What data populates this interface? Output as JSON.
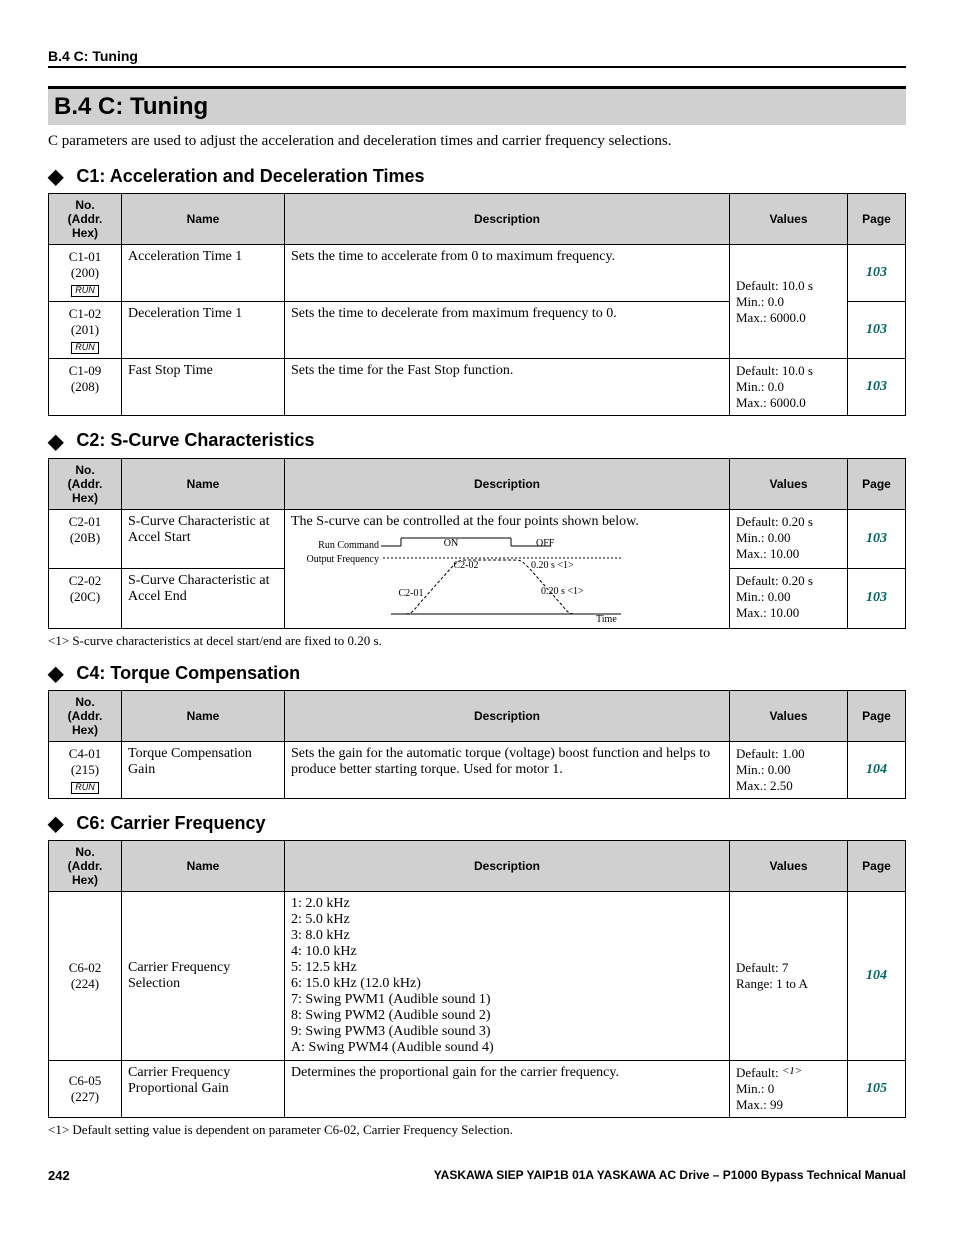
{
  "running_head": "B.4 C: Tuning",
  "section_title": "B.4   C: Tuning",
  "section_intro": "C parameters are used to adjust the acceleration and deceleration times and carrier frequency selections.",
  "subsections": {
    "c1": {
      "heading": "C1: Acceleration and Deceleration Times",
      "headers": {
        "no": "No.\n(Addr.\nHex)",
        "name": "Name",
        "desc": "Description",
        "values": "Values",
        "page": "Page"
      },
      "rows": [
        {
          "no_line1": "C1-01",
          "no_line2": "(200)",
          "run": "RUN",
          "name": "Acceleration Time 1",
          "desc": "Sets the time to accelerate from 0 to maximum frequency.",
          "page": "103"
        },
        {
          "no_line1": "C1-02",
          "no_line2": "(201)",
          "run": "RUN",
          "name": "Deceleration Time 1",
          "desc": "Sets the time to decelerate from maximum frequency to 0.",
          "page": "103"
        },
        {
          "no_line1": "C1-09",
          "no_line2": "(208)",
          "run": "",
          "name": "Fast Stop Time",
          "desc": "Sets the time for the Fast Stop function.",
          "values": "Default: 10.0 s\nMin.: 0.0\nMax.: 6000.0",
          "page": "103"
        }
      ],
      "shared_values_12": "Default: 10.0 s\nMin.: 0.0\nMax.: 6000.0"
    },
    "c2": {
      "heading": "C2: S-Curve Characteristics",
      "headers": {
        "no": "No.\n(Addr.\nHex)",
        "name": "Name",
        "desc": "Description",
        "values": "Values",
        "page": "Page"
      },
      "rows": [
        {
          "no_line1": "C2-01",
          "no_line2": "(20B)",
          "name": "S-Curve Characteristic at Accel Start",
          "values": "Default: 0.20 s\nMin.: 0.00\nMax.: 10.00",
          "page": "103"
        },
        {
          "no_line1": "C2-02",
          "no_line2": "(20C)",
          "name": "S-Curve Characteristic at Accel End",
          "values": "Default: 0.20 s\nMin.: 0.00\nMax.: 10.00",
          "page": "103"
        }
      ],
      "desc_intro": "The S-curve can be controlled at the four points shown below.",
      "diagram_labels": {
        "run_command": "Run Command",
        "on": "ON",
        "off": "OFF",
        "output_freq": "Output Frequency",
        "c2_01": "C2-01",
        "c2_02": "C2-02",
        "note_c2_02": "0.20 s <1>",
        "note_c2_01": "0.20 s <1>",
        "time": "Time"
      },
      "footnote": "<1>   S-curve characteristics at decel start/end are fixed to 0.20 s."
    },
    "c4": {
      "heading": "C4: Torque Compensation",
      "headers": {
        "no": "No.\n(Addr.\nHex)",
        "name": "Name",
        "desc": "Description",
        "values": "Values",
        "page": "Page"
      },
      "rows": [
        {
          "no_line1": "C4-01",
          "no_line2": "(215)",
          "run": "RUN",
          "name": "Torque Compensation Gain",
          "desc": "Sets the gain for the automatic torque (voltage) boost function and helps to produce better starting torque. Used for motor 1.",
          "values": "Default: 1.00\nMin.: 0.00\nMax.: 2.50",
          "page": "104"
        }
      ]
    },
    "c6": {
      "heading": "C6: Carrier Frequency",
      "headers": {
        "no": "No.\n(Addr.\nHex)",
        "name": "Name",
        "desc": "Description",
        "values": "Values",
        "page": "Page"
      },
      "rows": [
        {
          "no_line1": "C6-02",
          "no_line2": "(224)",
          "name": "Carrier Frequency Selection",
          "desc": "1: 2.0 kHz\n2: 5.0 kHz\n3: 8.0 kHz\n4: 10.0 kHz\n5: 12.5 kHz\n6: 15.0 kHz (12.0 kHz)\n7: Swing PWM1 (Audible sound 1)\n8: Swing PWM2 (Audible sound 2)\n9: Swing PWM3 (Audible sound 3)\nA: Swing PWM4 (Audible sound 4)",
          "values": "Default: 7\nRange: 1 to A",
          "page": "104"
        },
        {
          "no_line1": "C6-05",
          "no_line2": "(227)",
          "name": "Carrier Frequency Proportional Gain",
          "desc": "Determines the proportional gain for the carrier frequency.",
          "values_pre": "Default: ",
          "values_sup": "<1>",
          "values_post": "\nMin.: 0\nMax.: 99",
          "page": "105"
        }
      ],
      "footnote": "<1>   Default setting value is dependent on parameter C6-02, Carrier Frequency Selection."
    }
  },
  "footer": {
    "page_number": "242",
    "manual": "YASKAWA SIEP YAIP1B 01A YASKAWA AC Drive – P1000 Bypass Technical Manual"
  }
}
